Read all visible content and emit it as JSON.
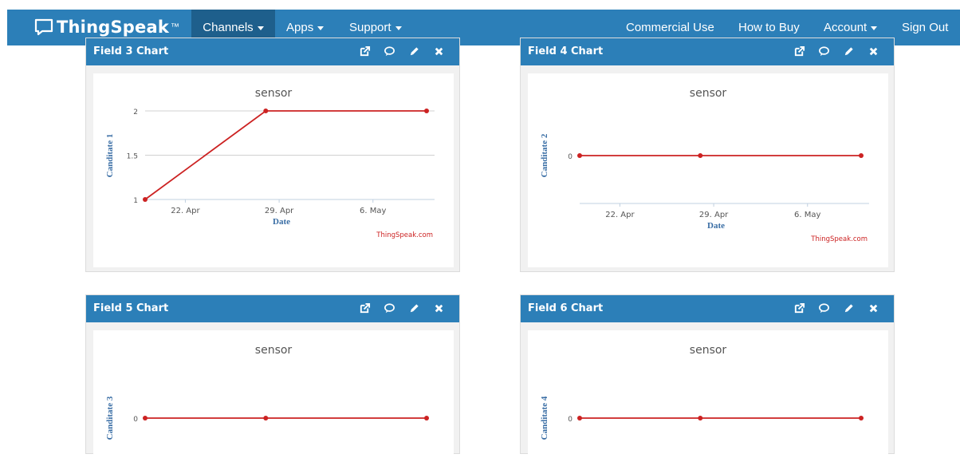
{
  "navbar": {
    "brand": "ThingSpeak",
    "brand_tm": "™",
    "items": [
      {
        "label": "Channels"
      },
      {
        "label": "Apps"
      },
      {
        "label": "Support"
      }
    ],
    "right_items": [
      {
        "label": "Commercial Use"
      },
      {
        "label": "How to Buy"
      },
      {
        "label": "Account"
      },
      {
        "label": "Sign Out"
      }
    ],
    "color": "#2c7fb8",
    "active_color": "#1e5f8c"
  },
  "panels": [
    {
      "title": "Field 3 Chart"
    },
    {
      "title": "Field 4 Chart"
    },
    {
      "title": "Field 5 Chart"
    },
    {
      "title": "Field 6 Chart"
    }
  ],
  "icons": [
    "external-link-icon",
    "comment-icon",
    "pencil-icon",
    "close-icon"
  ],
  "chart_data": [
    {
      "type": "line",
      "title": "sensor",
      "xlabel": "Date",
      "ylabel": "Canditate 1",
      "credit": "ThingSpeak.com",
      "x_ticks": [
        "22. Apr",
        "29. Apr",
        "6. May"
      ],
      "y_ticks": [
        "1",
        "1.5",
        "2"
      ],
      "ylim": [
        1,
        2
      ],
      "x": [
        "2018-04-19",
        "2018-04-28",
        "2018-05-10"
      ],
      "values": [
        1,
        2,
        2
      ],
      "color": "#cc2222"
    },
    {
      "type": "line",
      "title": "sensor",
      "xlabel": "Date",
      "ylabel": "Canditate 2",
      "credit": "ThingSpeak.com",
      "x_ticks": [
        "22. Apr",
        "29. Apr",
        "6. May"
      ],
      "y_ticks": [
        "0"
      ],
      "x": [
        "2018-04-19",
        "2018-04-28",
        "2018-05-10"
      ],
      "values": [
        0,
        0,
        0
      ],
      "color": "#cc2222"
    },
    {
      "type": "line",
      "title": "sensor",
      "ylabel": "Canditate 3",
      "y_ticks": [
        "0"
      ],
      "x": [
        "2018-04-19",
        "2018-04-28",
        "2018-05-10"
      ],
      "values": [
        0,
        0,
        0
      ],
      "color": "#cc2222"
    },
    {
      "type": "line",
      "title": "sensor",
      "ylabel": "Canditate 4",
      "y_ticks": [
        "0"
      ],
      "x": [
        "2018-04-19",
        "2018-04-28",
        "2018-05-10"
      ],
      "values": [
        0,
        0,
        0
      ],
      "color": "#cc2222"
    }
  ]
}
